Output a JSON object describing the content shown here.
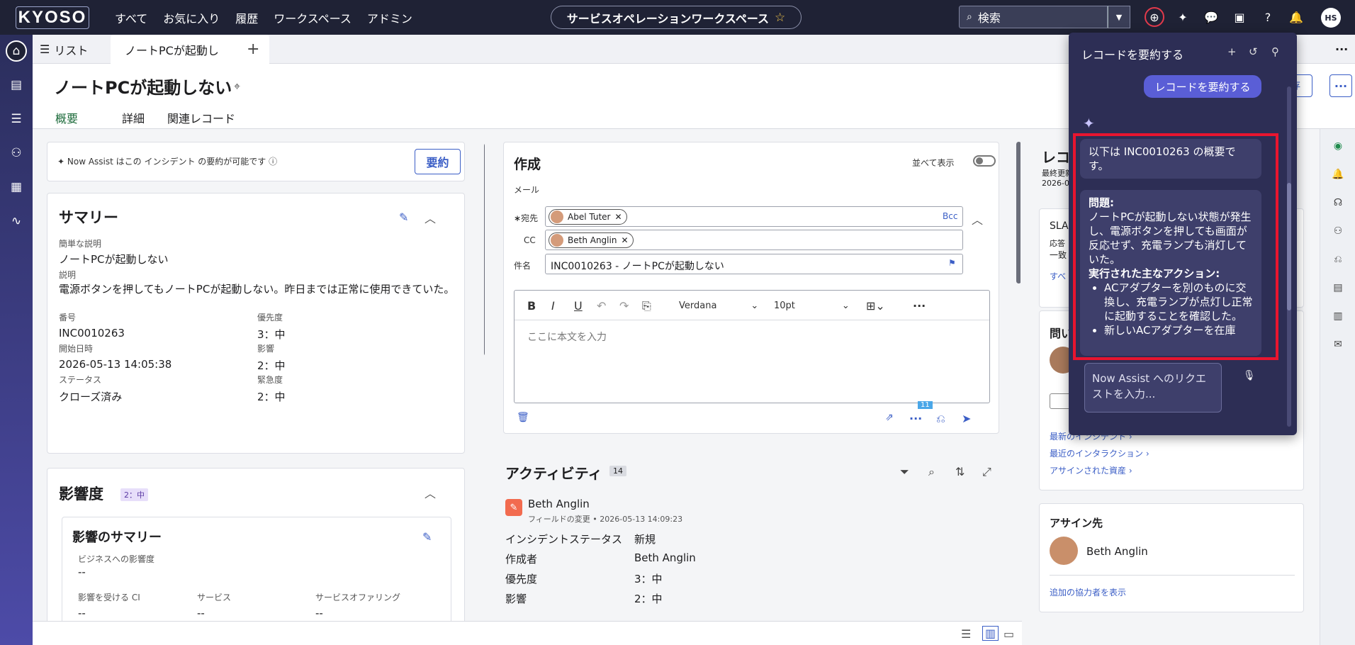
{
  "topnav": {
    "logo": "KYOSO",
    "links": [
      "すべて",
      "お気に入り",
      "履歴",
      "ワークスペース",
      "アドミン"
    ],
    "workspace": "サービスオペレーションワークスペース",
    "search_placeholder": "検索",
    "avatar_initials": "HS"
  },
  "tabs": {
    "list": "リスト",
    "active": "ノートPCが起動し"
  },
  "header": {
    "title": "ノートPCが起動しない",
    "subtabs": [
      "概要",
      "詳細",
      "関連レコード"
    ],
    "save_label": "存"
  },
  "assist_card": {
    "text": "Now Assist はこの インシデント の要約が可能です",
    "button": "要約"
  },
  "summary": {
    "title": "サマリー",
    "short_desc_label": "簡単な説明",
    "short_desc": "ノートPCが起動しない",
    "desc_label": "説明",
    "desc": "電源ボタンを押してもノートPCが起動しない。昨日までは正常に使用できていた。",
    "number_label": "番号",
    "number": "INC0010263",
    "priority_label": "優先度",
    "priority": "3：中",
    "opened_label": "開始日時",
    "opened": "2026-05-13 14:05:38",
    "impact_label": "影響",
    "impact": "2：中",
    "status_label": "ステータス",
    "status": "クローズ済み",
    "urgency_label": "緊急度",
    "urgency": "2：中"
  },
  "impact_card": {
    "title": "影響度",
    "badge": "2：中",
    "inner_title": "影響のサマリー",
    "biz_label": "ビジネスへの影響度",
    "biz_value": "--",
    "ci_label": "影響を受ける CI",
    "service_label": "サービス",
    "offering_label": "サービスオファリング",
    "ci_value": "--",
    "service_value": "--",
    "offering_value": "--"
  },
  "compose": {
    "title": "作成",
    "side_by_side": "並べて表示",
    "mail_label": "メール",
    "to_label": "宛先",
    "to_chip": "Abel Tuter",
    "bcc": "Bcc",
    "cc_label": "CC",
    "cc_chip": "Beth Anglin",
    "subject_label": "件名",
    "subject": "INC0010263 - ノートPCが起動しない",
    "font": "Verdana",
    "size": "10pt",
    "body_placeholder": "ここに本文を入力",
    "badge": "11"
  },
  "activity": {
    "title": "アクティビティ",
    "count": "14",
    "author": "Beth Anglin",
    "meta": "フィールドの変更 • 2026-05-13 14:09:23",
    "rows": [
      {
        "label": "インシデントステータス",
        "value": "新規"
      },
      {
        "label": "作成者",
        "value": "Beth Anglin"
      },
      {
        "label": "優先度",
        "value": "3：中"
      },
      {
        "label": "影響",
        "value": "2：中"
      }
    ]
  },
  "right": {
    "record_title": "レコ",
    "last_updated": "最終更新",
    "date_prefix": "2026-0",
    "sla": "SLA",
    "response": "応答",
    "one": "一致",
    "see": "すべ",
    "inquiry": "問い",
    "recent_incidents": "最新のインシデント",
    "recent_interactions": "最近のインタラクション",
    "assigned_assets": "アサインされた資産",
    "assignee_title": "アサイン先",
    "assignee": "Beth Anglin",
    "collaborators": "追加の協力者を表示"
  },
  "flyout": {
    "title": "レコードを要約する",
    "user_bubble": "レコードを要約する",
    "msg1": "以下は INC0010263 の概要です。",
    "problem_label": "問題:",
    "problem": "ノートPCが起動しない状態が発生し、電源ボタンを押しても画面が反応せず、充電ランプも消灯していた。",
    "actions_label": "実行された主なアクション:",
    "action1": "ACアダプターを別のものに交換し、充電ランプが点灯し正常に起動することを確認した。",
    "action2": "新しいACアダプターを在庫",
    "input_placeholder": "Now Assist へのリクエストを入力..."
  }
}
